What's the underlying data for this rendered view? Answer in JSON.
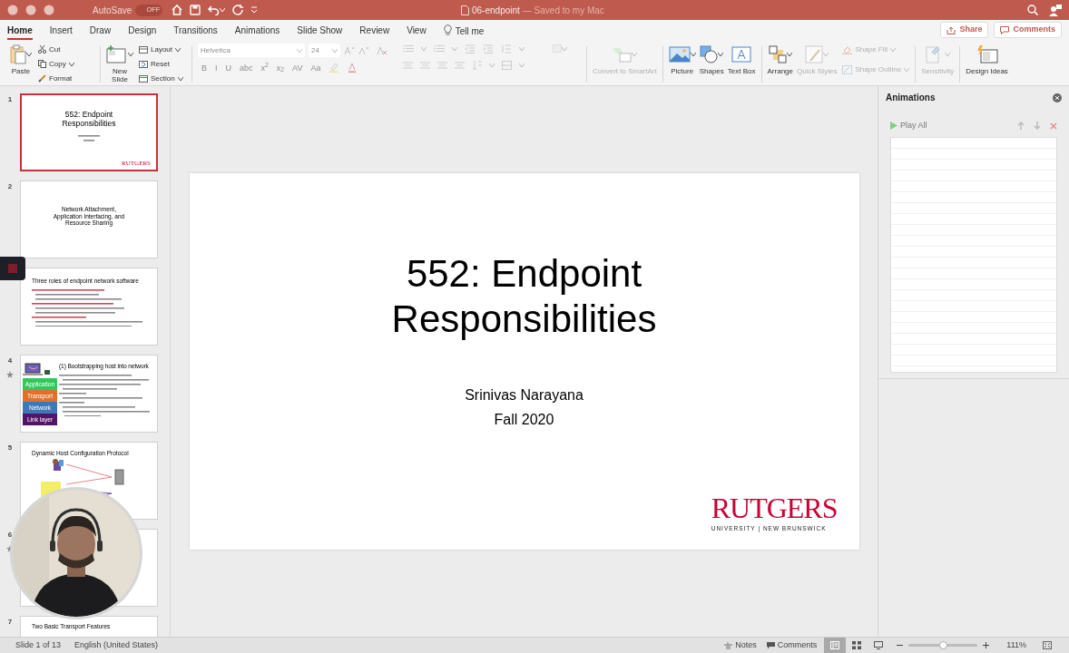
{
  "window": {
    "title": "06-endpoint",
    "subtitle": "— Saved to my Mac"
  },
  "autosave": {
    "label": "AutoSave",
    "toggle": "OFF",
    "on": false
  },
  "tabs": [
    {
      "label": "Home",
      "selected": true
    },
    {
      "label": "Insert",
      "selected": false
    },
    {
      "label": "Draw",
      "selected": false
    },
    {
      "label": "Design",
      "selected": false
    },
    {
      "label": "Transitions",
      "selected": false
    },
    {
      "label": "Animations",
      "selected": false
    },
    {
      "label": "Slide Show",
      "selected": false
    },
    {
      "label": "Review",
      "selected": false
    },
    {
      "label": "View",
      "selected": false
    }
  ],
  "tell_me": "Tell me",
  "share": "Share",
  "comments_button": "Comments",
  "clipboard": {
    "paste": {
      "label": "Paste",
      "disabled": false
    },
    "cut": {
      "label": "Cut",
      "disabled": false
    },
    "copy": {
      "label": "Copy",
      "disabled": false
    },
    "format": {
      "label": "Format",
      "disabled": false
    }
  },
  "slides_group": {
    "new_slide": {
      "label": "New Slide",
      "disabled": false
    },
    "layout": {
      "label": "Layout",
      "disabled": false
    },
    "reset": {
      "label": "Reset",
      "disabled": false
    },
    "section": {
      "label": "Section",
      "disabled": false
    }
  },
  "font": {
    "name": "Helvetica",
    "size": "24",
    "disabled": true,
    "styles": [
      "B",
      "I",
      "U",
      "abc",
      "x$^{2}$",
      "x$_{2}$",
      "AV",
      "Aa"
    ]
  },
  "insert": {
    "convert": {
      "label": "Convert to SmartArt",
      "disabled": true
    },
    "picture": {
      "label": "Picture",
      "disabled": false
    },
    "shapes": {
      "label": "Shapes",
      "disabled": false
    },
    "text_box": {
      "label": "Text Box",
      "disabled": false
    }
  },
  "drawing": {
    "arrange": {
      "label": "Arrange",
      "disabled": false
    },
    "quick_styles": {
      "label": "Quick Styles",
      "disabled": true
    },
    "shape_fill": {
      "label": "Shape Fill",
      "disabled": true
    },
    "shape_outline": {
      "label": "Shape Outline",
      "disabled": true
    }
  },
  "sensitivity": {
    "label": "Sensitivity",
    "disabled": true
  },
  "design_ideas": {
    "label": "Design Ideas",
    "disabled": false
  },
  "slides": [
    {
      "number": "1",
      "selected": true,
      "starred": false,
      "kind": "title",
      "title": "552: Endpoint Responsibilities",
      "logo": "RUTGERS"
    },
    {
      "number": "2",
      "selected": false,
      "starred": false,
      "kind": "section",
      "title": "Network Attachment, Application Interfacing, and Resource Sharing"
    },
    {
      "selected": false,
      "starred": false,
      "kind": "bullets",
      "title": "Three roles of endpoint network software"
    },
    {
      "number": "4",
      "selected": false,
      "starred": true,
      "kind": "layers",
      "title": "(1) Bootstrapping host into network",
      "layers": [
        {
          "label": "Application",
          "color": "#2fc95a"
        },
        {
          "label": "Transport",
          "color": "#e2702c"
        },
        {
          "label": "Network",
          "color": "#3f78b8"
        },
        {
          "label": "Link layer",
          "color": "#521466"
        }
      ]
    },
    {
      "number": "5",
      "selected": false,
      "starred": false,
      "kind": "diagram",
      "title": "Dynamic Host Configuration Protocol"
    },
    {
      "number": "6",
      "selected": false,
      "starred": true,
      "kind": "hidden"
    },
    {
      "number": "7",
      "selected": false,
      "starred": false,
      "kind": "title_only",
      "title": "Two Basic Transport Features"
    }
  ],
  "slide": {
    "title": "552: Endpoint Responsibilities",
    "subtitle_lines": [
      "Srinivas Narayana",
      "Fall 2020"
    ],
    "logo": {
      "name": "RUTGERS",
      "tagline": "UNIVERSITY | NEW BRUNSWICK"
    }
  },
  "animations_pane": {
    "title": "Animations",
    "play_all": "Play All"
  },
  "status_bar": {
    "slide": "Slide 1 of 13",
    "language": "English (United States)",
    "notes": "Notes",
    "comments": "Comments",
    "views": [
      {
        "kind": "normal",
        "selected": true
      },
      {
        "kind": "sorter",
        "selected": false
      },
      {
        "kind": "reading",
        "selected": false
      }
    ],
    "zoom": {
      "level": 0.5
    },
    "zoom_text": "111%"
  }
}
